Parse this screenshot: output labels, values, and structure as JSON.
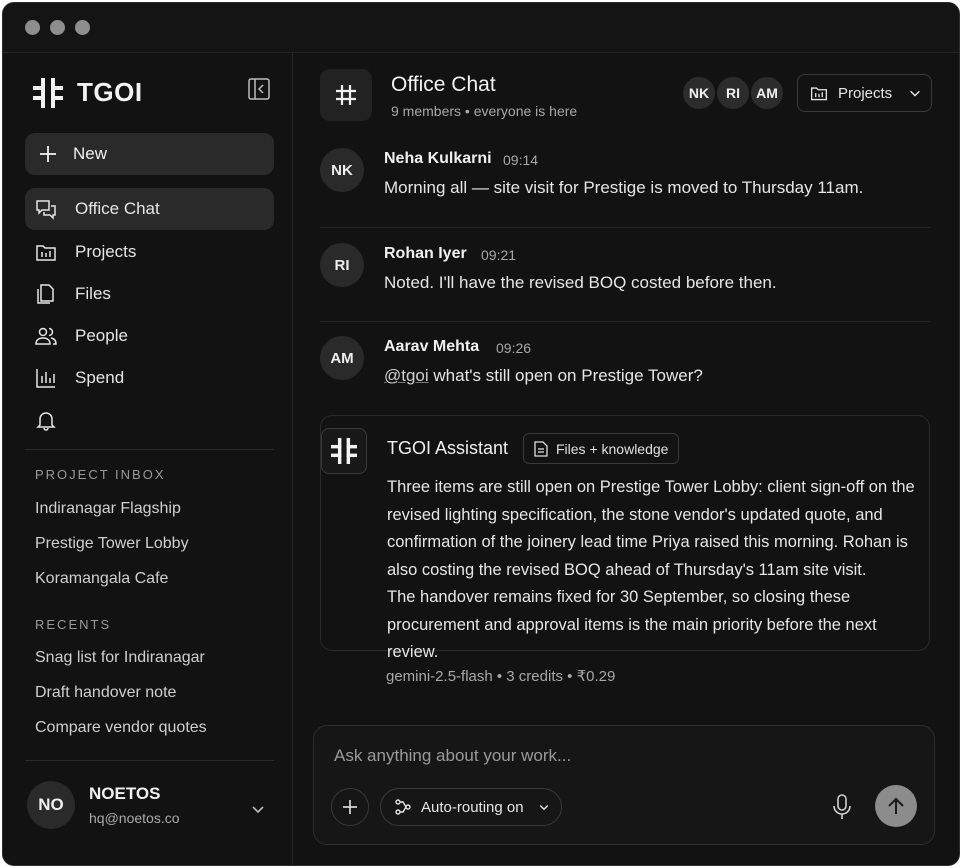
{
  "app": {
    "name": "TGOI"
  },
  "sidebar": {
    "new_label": "New",
    "nav": [
      {
        "label": "Office Chat",
        "icon": "chat-icon",
        "active": true
      },
      {
        "label": "Projects",
        "icon": "projects-icon"
      },
      {
        "label": "Files",
        "icon": "files-icon"
      },
      {
        "label": "People",
        "icon": "people-icon"
      },
      {
        "label": "Spend",
        "icon": "chart-icon"
      }
    ],
    "bell_icon": "bell-icon",
    "project_inbox_label": "PROJECT INBOX",
    "projects": [
      "Indiranagar Flagship",
      "Prestige Tower Lobby",
      "Koramangala Cafe"
    ],
    "recents_label": "RECENTS",
    "recents": [
      "Snag list for Indiranagar",
      "Draft handover note",
      "Compare vendor quotes"
    ],
    "user": {
      "initials": "NO",
      "name": "NOETOS",
      "email": "hq@noetos.co"
    }
  },
  "header": {
    "title": "Office Chat",
    "subtitle": "9 members • everyone is here",
    "members": [
      "NK",
      "RI",
      "AM"
    ],
    "projects_button": "Projects"
  },
  "messages": [
    {
      "initials": "NK",
      "name": "Neha Kulkarni",
      "time": "09:14",
      "text": "Morning all — site visit for Prestige is moved to Thursday 11am."
    },
    {
      "initials": "RI",
      "name": "Rohan Iyer",
      "time": "09:21",
      "text": "Noted. I'll have the revised BOQ costed before then."
    },
    {
      "initials": "AM",
      "name": "Aarav Mehta",
      "time": "09:26",
      "mention": "@tgoi",
      "text": " what's still open on Prestige Tower?"
    }
  ],
  "assistant": {
    "name": "TGOI Assistant",
    "chip": "Files + knowledge",
    "paragraph1": "Three items are still open on Prestige Tower Lobby: client sign-off on the revised lighting specification, the stone vendor's updated quote, and confirmation of the joinery lead time Priya raised this morning. Rohan is also costing the revised BOQ ahead of Thursday's 11am site visit.",
    "paragraph2": "The handover remains fixed for 30 September, so closing these procurement and approval items is the main priority before the next review.",
    "meta": "gemini-2.5-flash • 3 credits • ₹0.29"
  },
  "composer": {
    "placeholder": "Ask anything about your work...",
    "routing_label": "Auto-routing on"
  }
}
